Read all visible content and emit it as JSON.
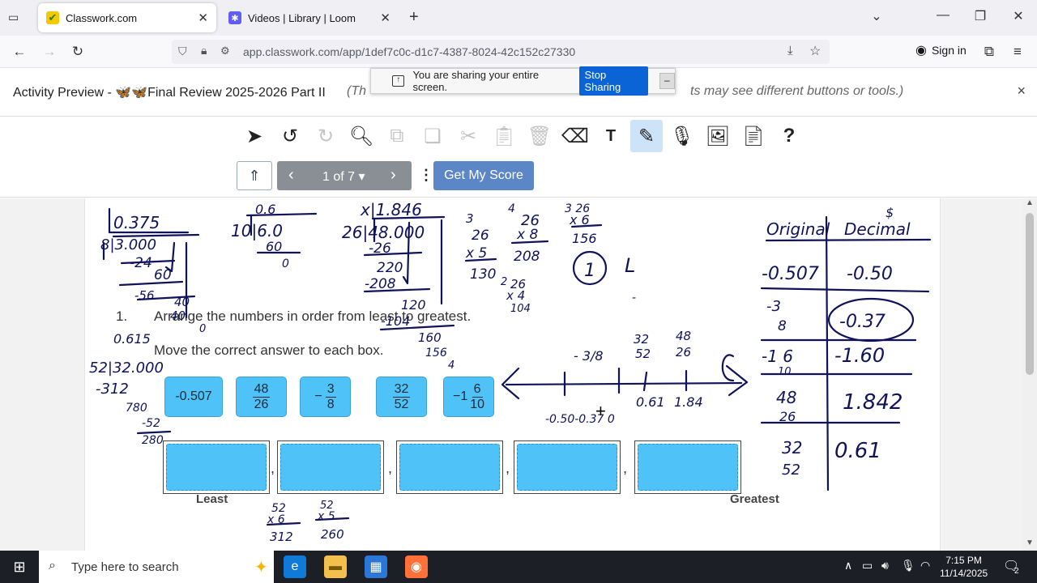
{
  "browser": {
    "tabs": [
      {
        "title": "Classwork.com",
        "active": true
      },
      {
        "title": "Videos | Library | Loom",
        "active": false
      }
    ],
    "new_tab": "+",
    "url": "app.classwork.com/app/1def7c0c-d1c7-4387-8024-42c152c27330",
    "sign_in": "Sign in"
  },
  "share_banner": {
    "message": "You are sharing your entire screen.",
    "stop_label": "Stop Sharing",
    "minimize": "–"
  },
  "activity": {
    "title": "Activity Preview - 🦋🦋Final Review 2025-2026 Part II",
    "note_prefix": "(Th",
    "note_suffix": "ts may see different buttons or tools.)",
    "close": "×"
  },
  "toolbar": {
    "pager": "1 of 7",
    "score_button": "Get My Score",
    "help": "?"
  },
  "question": {
    "number": "1.",
    "prompt": "Arrange the numbers in order from least to greatest.",
    "instruction": "Move the correct answer to each box.",
    "cards": [
      {
        "sign": "",
        "whole": "-0.507",
        "num": "",
        "den": ""
      },
      {
        "sign": "",
        "whole": "",
        "num": "48",
        "den": "26"
      },
      {
        "sign": "−",
        "whole": "",
        "num": "3",
        "den": "8"
      },
      {
        "sign": "",
        "whole": "",
        "num": "32",
        "den": "52"
      },
      {
        "sign": "−",
        "whole": "1",
        "num": "6",
        "den": "10"
      }
    ],
    "least_label": "Least",
    "greatest_label": "Greatest",
    "separator": ","
  },
  "taskbar": {
    "search_placeholder": "Type here to search",
    "time": "7:15 PM",
    "date": "11/14/2025",
    "notifications": "2"
  }
}
